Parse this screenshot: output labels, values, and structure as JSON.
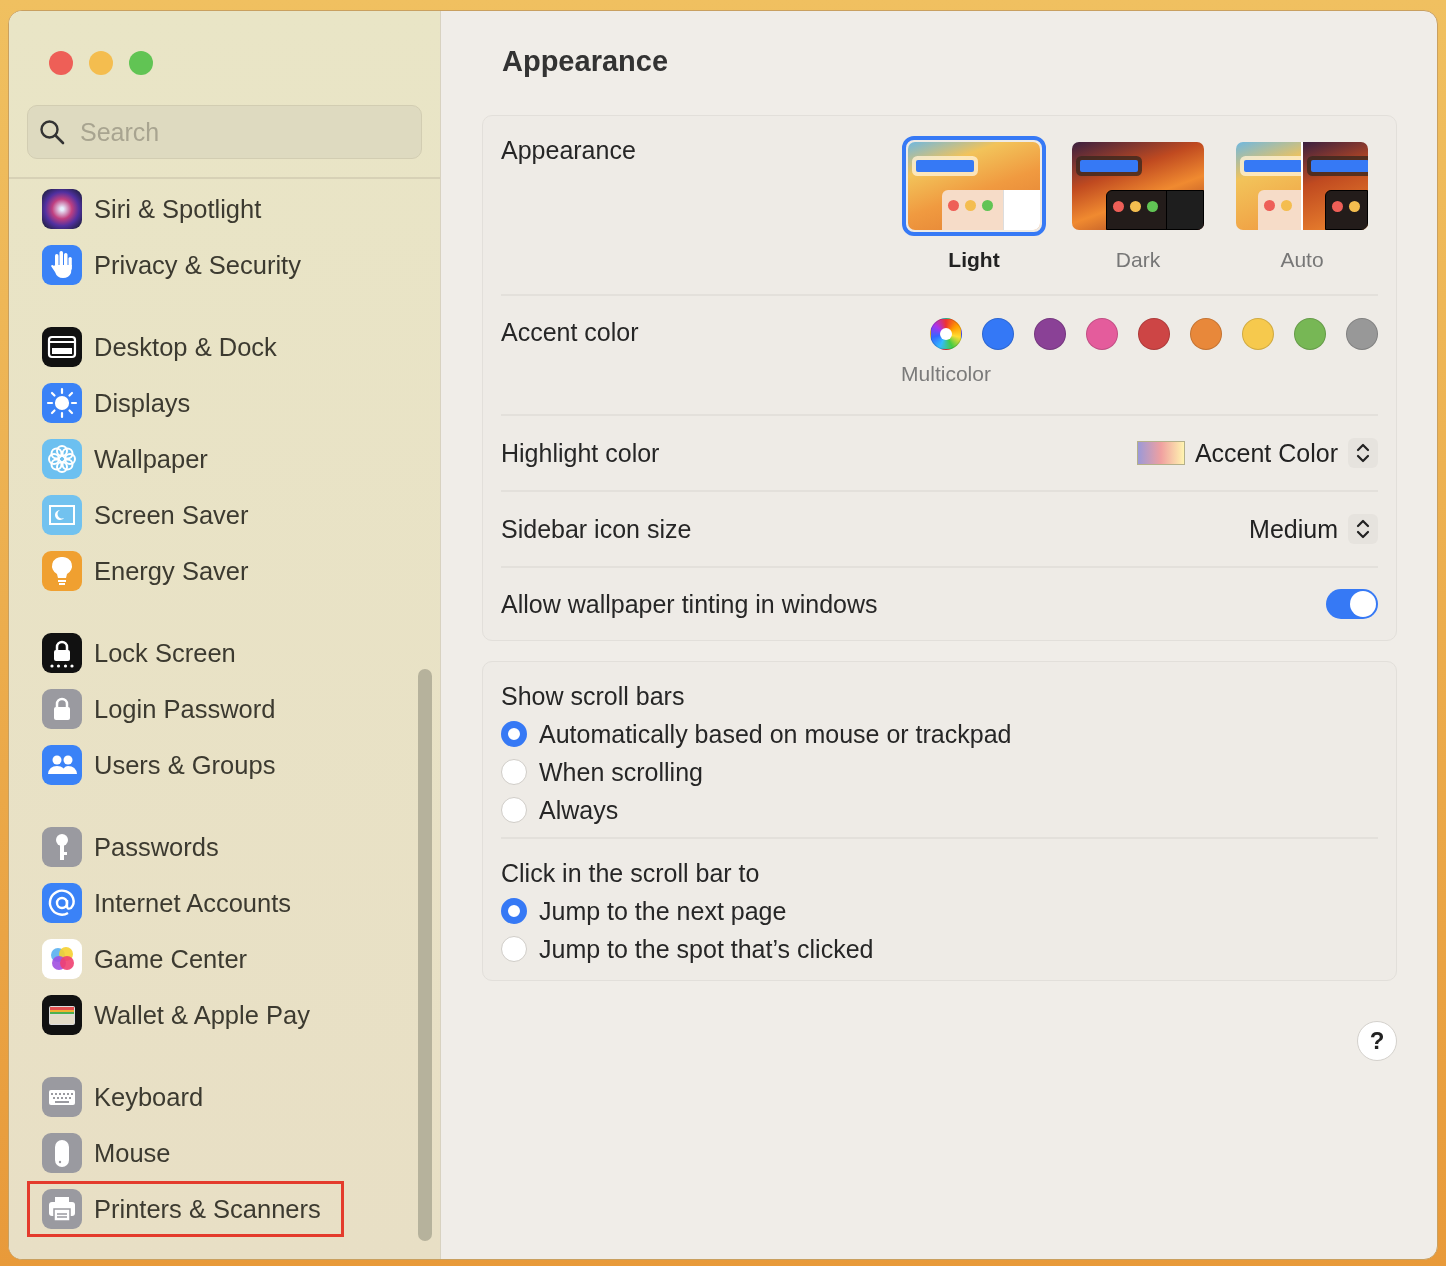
{
  "sidebar": {
    "search": {
      "placeholder": "Search"
    },
    "groups": [
      [
        {
          "label": "Siri & Spotlight",
          "highlighted": false
        },
        {
          "label": "Privacy & Security",
          "highlighted": false
        }
      ],
      [
        {
          "label": "Desktop & Dock",
          "highlighted": false
        },
        {
          "label": "Displays",
          "highlighted": false
        },
        {
          "label": "Wallpaper",
          "highlighted": false
        },
        {
          "label": "Screen Saver",
          "highlighted": false
        },
        {
          "label": "Energy Saver",
          "highlighted": false
        }
      ],
      [
        {
          "label": "Lock Screen",
          "highlighted": false
        },
        {
          "label": "Login Password",
          "highlighted": false
        },
        {
          "label": "Users & Groups",
          "highlighted": false
        }
      ],
      [
        {
          "label": "Passwords",
          "highlighted": false
        },
        {
          "label": "Internet Accounts",
          "highlighted": false
        },
        {
          "label": "Game Center",
          "highlighted": false
        },
        {
          "label": "Wallet & Apple Pay",
          "highlighted": false
        }
      ],
      [
        {
          "label": "Keyboard",
          "highlighted": false
        },
        {
          "label": "Mouse",
          "highlighted": false
        },
        {
          "label": "Printers & Scanners",
          "highlighted": true
        }
      ]
    ]
  },
  "title": "Appearance",
  "appearance": {
    "label": "Appearance",
    "options": [
      {
        "kind": "light",
        "label": "Light",
        "selected": true
      },
      {
        "kind": "dark",
        "label": "Dark",
        "selected": false
      },
      {
        "kind": "auto",
        "label": "Auto",
        "selected": false
      }
    ]
  },
  "accent": {
    "label": "Accent color",
    "colors": [
      {
        "kind": "multicolor",
        "name": "Multicolor",
        "selected": true
      },
      {
        "kind": "solid",
        "color": "#3478f6",
        "selected": false
      },
      {
        "kind": "solid",
        "color": "#8a4196",
        "selected": false
      },
      {
        "kind": "solid",
        "color": "#e45c9c",
        "selected": false
      },
      {
        "kind": "solid",
        "color": "#cd4545",
        "selected": false
      },
      {
        "kind": "solid",
        "color": "#e8883a",
        "selected": false
      },
      {
        "kind": "solid",
        "color": "#f6c94d",
        "selected": false
      },
      {
        "kind": "solid",
        "color": "#77b755",
        "selected": false
      },
      {
        "kind": "solid",
        "color": "#989898",
        "selected": false
      }
    ]
  },
  "highlight": {
    "label": "Highlight color",
    "value": "Accent Color"
  },
  "icon_size": {
    "label": "Sidebar icon size",
    "value": "Medium"
  },
  "tinting": {
    "label": "Allow wallpaper tinting in windows",
    "on": true
  },
  "scroll_bars": {
    "label": "Show scroll bars",
    "options": [
      {
        "label": "Automatically based on mouse or trackpad",
        "selected": true
      },
      {
        "label": "When scrolling",
        "selected": false
      },
      {
        "label": "Always",
        "selected": false
      }
    ]
  },
  "click_scroll": {
    "label": "Click in the scroll bar to",
    "options": [
      {
        "label": "Jump to the next page",
        "selected": true
      },
      {
        "label": "Jump to the spot that’s clicked",
        "selected": false
      }
    ]
  },
  "help": "?"
}
